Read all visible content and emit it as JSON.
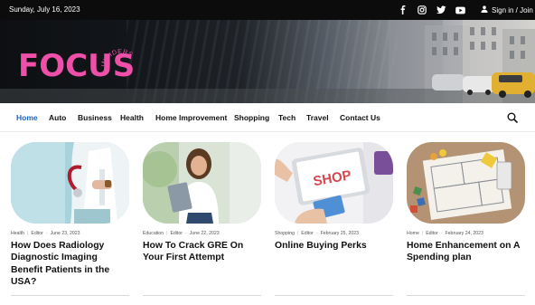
{
  "topbar": {
    "date": "Sunday, July 16, 2023",
    "social": [
      "facebook-icon",
      "instagram-icon",
      "twitter-icon",
      "youtube-icon"
    ],
    "signin_label": "Sign in / Join"
  },
  "brand": {
    "name": "FOCUS",
    "tagline": "INSIDERS",
    "color": "#ee4fa8"
  },
  "nav": {
    "items": [
      "Home",
      "Auto",
      "Business",
      "Health",
      "Home Improvement",
      "Shopping",
      "Tech",
      "Travel",
      "Contact Us"
    ],
    "active_color": "#1e63c7"
  },
  "articles": [
    {
      "category": "Health",
      "author": "Editor",
      "date": "June 23, 2023",
      "title": "How Does Radiology Diagnostic Imaging Benefit Patients in the USA?"
    },
    {
      "category": "Education",
      "author": "Editor",
      "date": "June 22, 2023",
      "title": "How To Crack GRE On Your First Attempt"
    },
    {
      "category": "Shopping",
      "author": "Editor",
      "date": "February 25, 2023",
      "title": "Online Buying Perks"
    },
    {
      "category": "Home",
      "author": "Editor",
      "date": "February 24, 2023",
      "title": "Home Enhancement on A Spending plan"
    }
  ],
  "shop_sign": "SHOP"
}
